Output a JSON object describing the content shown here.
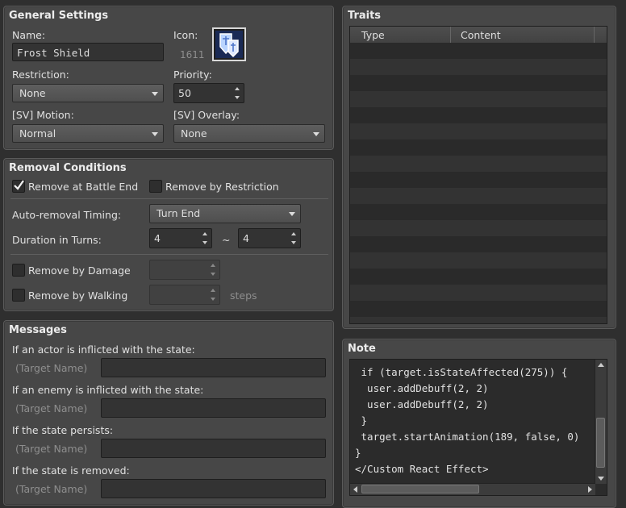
{
  "general": {
    "title": "General Settings",
    "name_label": "Name:",
    "name_value": "Frost Shield",
    "icon_label": "Icon:",
    "icon_index": "1611",
    "restriction_label": "Restriction:",
    "restriction_value": "None",
    "priority_label": "Priority:",
    "priority_value": "50",
    "motion_label": "[SV] Motion:",
    "motion_value": "Normal",
    "overlay_label": "[SV] Overlay:",
    "overlay_value": "None"
  },
  "removal": {
    "title": "Removal Conditions",
    "battle_end_label": "Remove at Battle End",
    "battle_end_checked": true,
    "restriction_label": "Remove by Restriction",
    "restriction_checked": false,
    "timing_label": "Auto-removal Timing:",
    "timing_value": "Turn End",
    "duration_label": "Duration in Turns:",
    "duration_min": "4",
    "duration_tilde": "~",
    "duration_max": "4",
    "damage_label": "Remove by Damage",
    "damage_checked": false,
    "walking_label": "Remove by Walking",
    "walking_checked": false,
    "steps_label": "steps"
  },
  "messages": {
    "title": "Messages",
    "actor_label": "If an actor is inflicted with the state:",
    "enemy_label": "If an enemy is inflicted with the state:",
    "persist_label": "If the state persists:",
    "removed_label": "If the state is removed:",
    "target_name": "(Target Name)"
  },
  "traits": {
    "title": "Traits",
    "col_type": "Type",
    "col_content": "Content"
  },
  "note": {
    "title": "Note",
    "lines": [
      " if (target.isStateAffected(275)) {",
      "  user.addDebuff(2, 2)",
      "  user.addDebuff(2, 2)",
      " }",
      " target.startAnimation(189, false, 0)",
      "}",
      "</Custom React Effect>"
    ]
  },
  "colors": {
    "panel": "#474747",
    "field": "#333333",
    "background": "#2f2f2f"
  }
}
